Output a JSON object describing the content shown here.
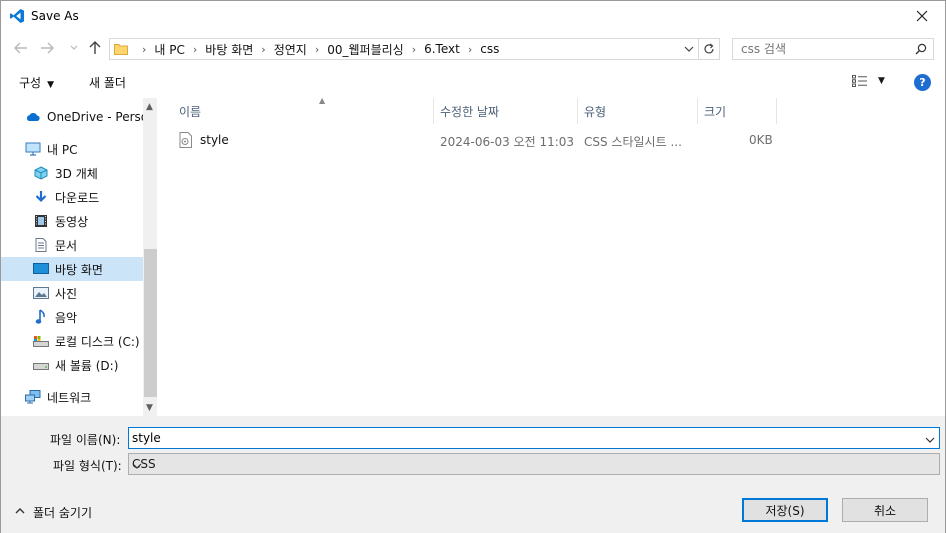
{
  "window": {
    "title": "Save As"
  },
  "address": {
    "crumbs": [
      "내 PC",
      "바탕 화면",
      "정연지",
      "00_웹퍼블리싱",
      "6.Text",
      "css"
    ]
  },
  "search": {
    "placeholder": "css 검색"
  },
  "toolbar": {
    "organize_label": "구성",
    "new_folder_label": "새 폴더"
  },
  "nav": {
    "items": [
      {
        "label": "OneDrive - Person",
        "icon": "onedrive-icon"
      },
      {
        "label": "내 PC",
        "icon": "pc-icon"
      },
      {
        "label": "3D 개체",
        "icon": "3d-objects-icon"
      },
      {
        "label": "다운로드",
        "icon": "download-icon"
      },
      {
        "label": "동영상",
        "icon": "video-icon"
      },
      {
        "label": "문서",
        "icon": "document-icon"
      },
      {
        "label": "바탕 화면",
        "icon": "desktop-icon",
        "selected": true
      },
      {
        "label": "사진",
        "icon": "pictures-icon"
      },
      {
        "label": "음악",
        "icon": "music-icon"
      },
      {
        "label": "로컬 디스크 (C:)",
        "icon": "local-disk-icon"
      },
      {
        "label": "새 볼륨 (D:)",
        "icon": "drive-icon"
      },
      {
        "label": "네트워크",
        "icon": "network-icon"
      }
    ]
  },
  "filelist": {
    "columns": [
      "이름",
      "수정한 날짜",
      "유형",
      "크기"
    ],
    "rows": [
      {
        "name": "style",
        "modified": "2024-06-03 오전 11:03",
        "type": "CSS 스타일시트 ...",
        "size": "0KB"
      }
    ]
  },
  "form": {
    "filename_label": "파일 이름(N):",
    "filename_value": "style",
    "filetype_label": "파일 형식(T):",
    "filetype_value": "CSS"
  },
  "footer": {
    "hide_folders_label": "폴더 숨기기",
    "save_label": "저장(S)",
    "cancel_label": "취소"
  },
  "colors": {
    "accent": "#0078d7",
    "selection": "#cce4f7",
    "help": "#1f6dd1"
  }
}
